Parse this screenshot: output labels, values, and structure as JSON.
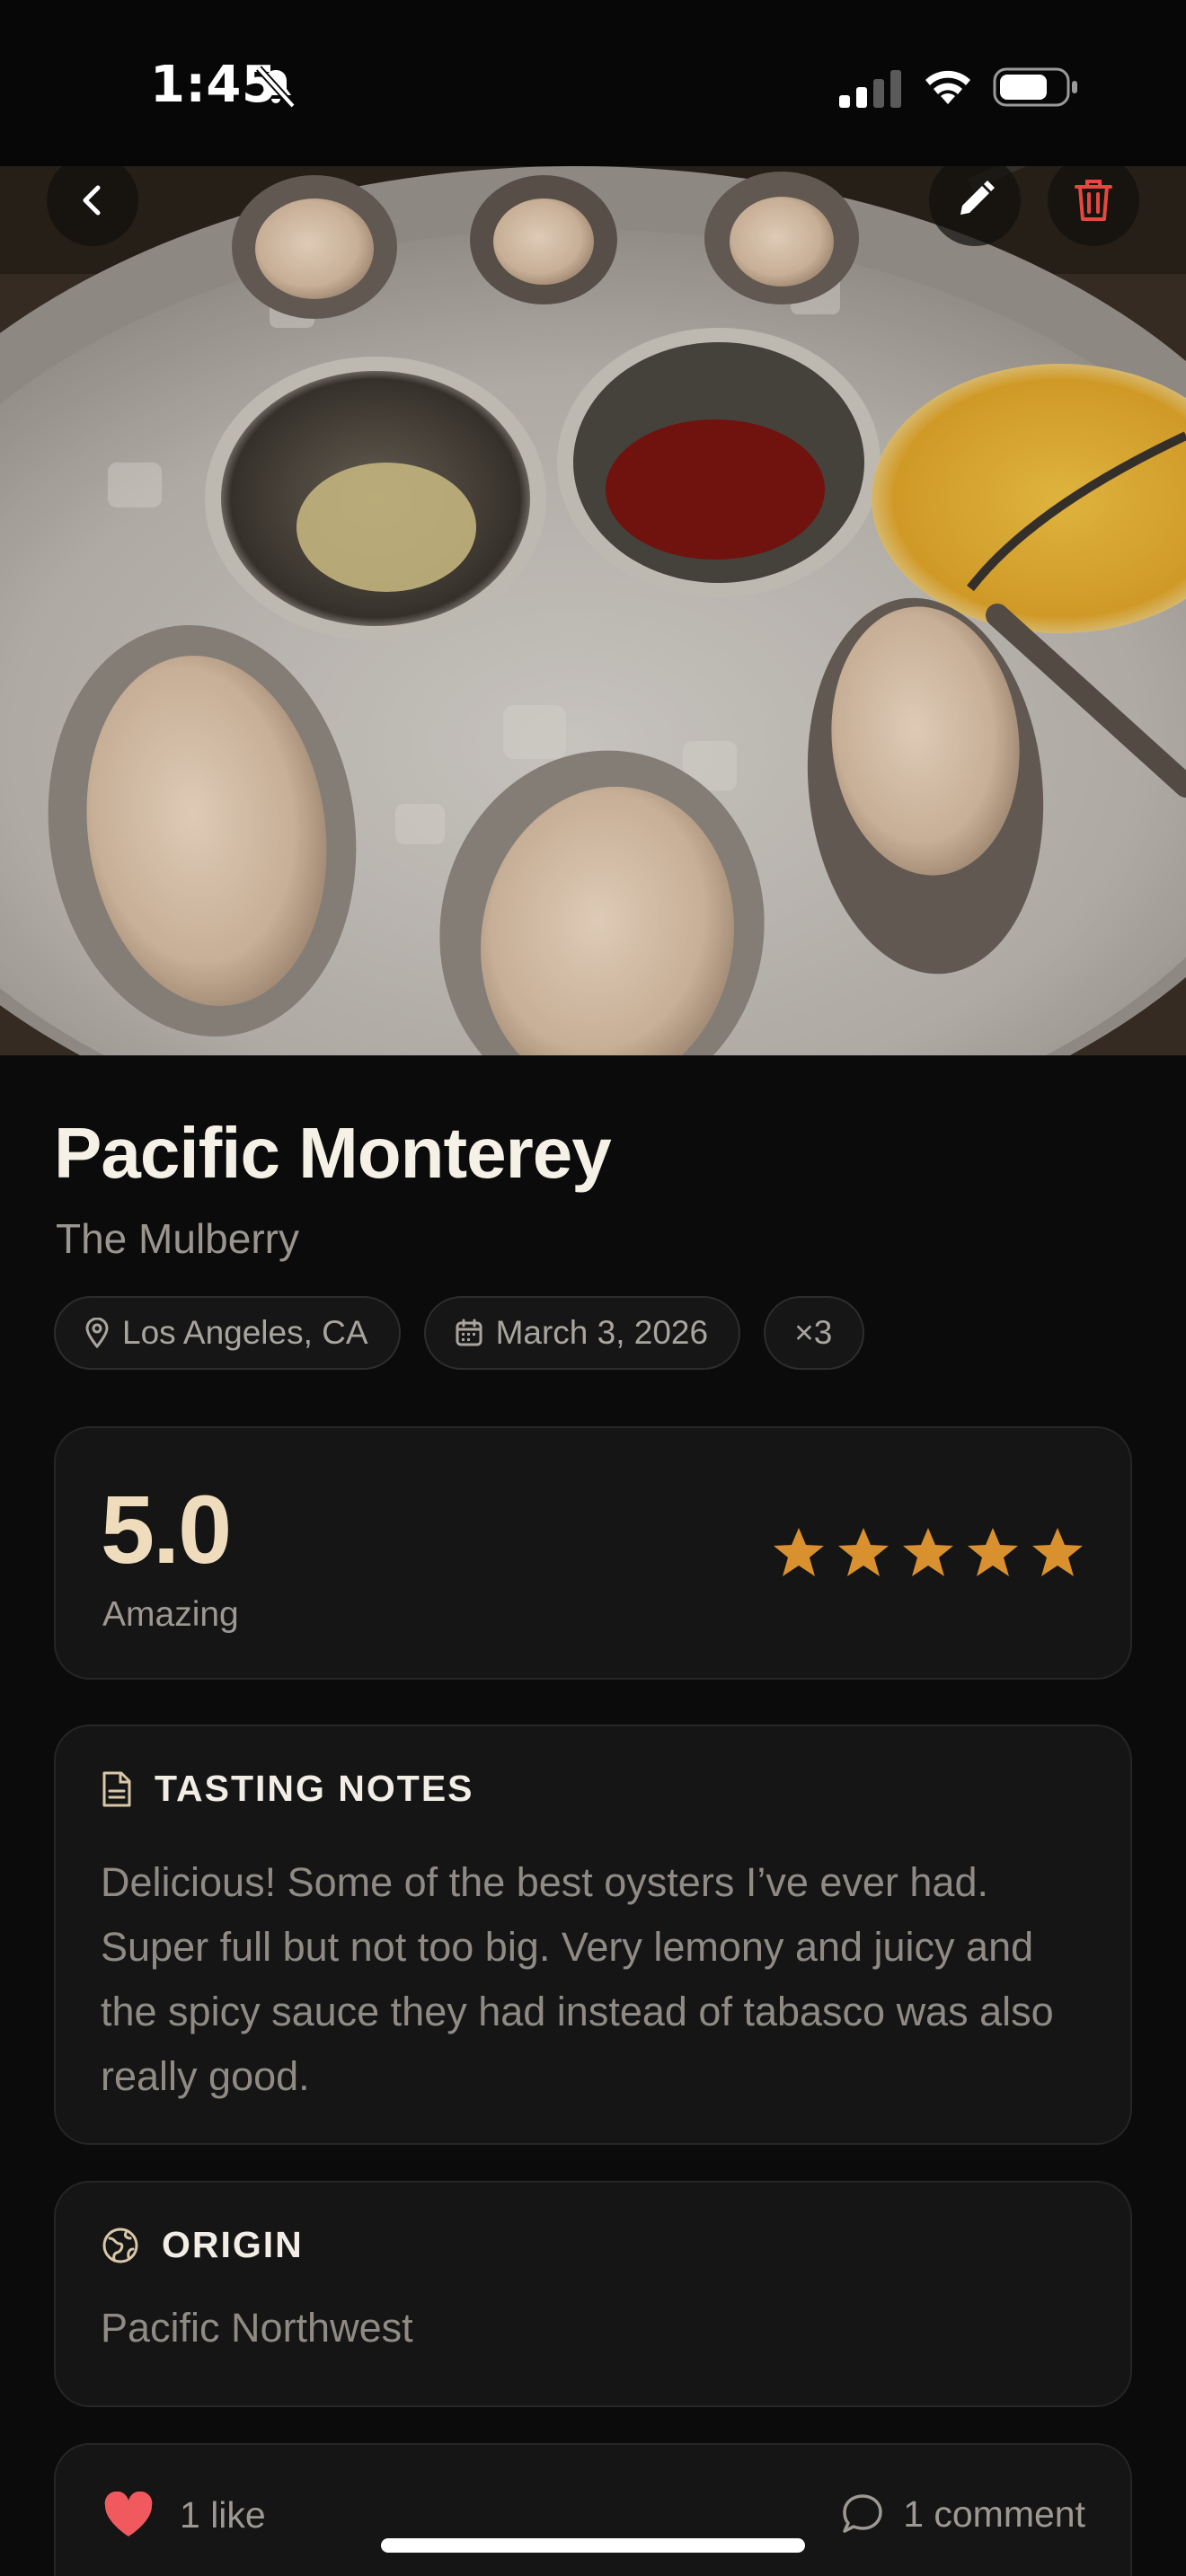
{
  "status_bar": {
    "time": "1:45"
  },
  "header_actions": {
    "back": "chevron-left-icon",
    "edit": "pencil-icon",
    "delete": "trash-icon"
  },
  "oyster": {
    "name": "Pacific Monterey",
    "restaurant": "The Mulberry",
    "location": "Los Angeles, CA",
    "date": "March 3, 2026",
    "quantity": "×3"
  },
  "rating": {
    "value": "5.0",
    "label": "Amazing",
    "stars_filled": 5,
    "stars_total": 5,
    "star_color": "#d9902f"
  },
  "tasting_notes": {
    "title": "TASTING NOTES",
    "text": "Delicious! Some of the best oysters I’ve ever had. Super full but not too big. Very lemony and juicy and the spicy sauce they had instead of tabasco was also really good."
  },
  "origin": {
    "title": "ORIGIN",
    "value": "Pacific Northwest"
  },
  "social": {
    "likes": "1 like",
    "comments": "1 comment",
    "heart_color": "#f0595e"
  },
  "colors": {
    "background": "#0b0b0b",
    "card": "#151515",
    "accent": "#efdcbd",
    "delete": "#e5483f"
  }
}
